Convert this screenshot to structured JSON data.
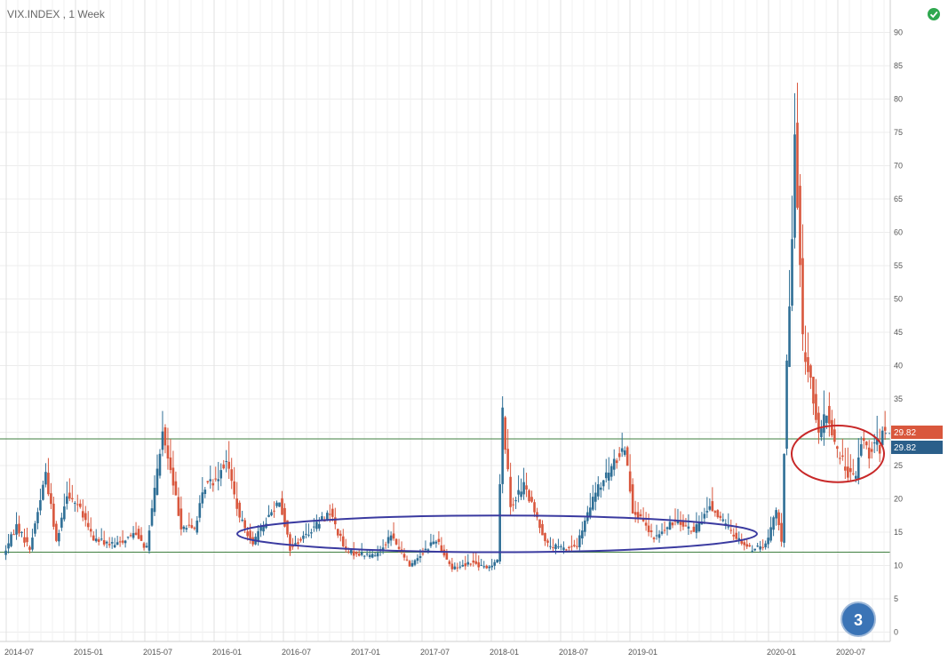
{
  "chart_data": {
    "type": "candlestick",
    "title": "VIX.INDEX , 1 Week",
    "ylim": [
      0,
      93
    ],
    "y_ticks": [
      0,
      5,
      10,
      15,
      20,
      25,
      30,
      35,
      40,
      45,
      50,
      55,
      60,
      65,
      70,
      75,
      80,
      85,
      90
    ],
    "x_tick_labels": [
      "2014-07",
      "2015-01",
      "2015-07",
      "2016-01",
      "2016-07",
      "2017-01",
      "2017-07",
      "2018-01",
      "2018-07",
      "2019-01",
      "2020-01",
      "2020-07"
    ],
    "grid": true,
    "up_color": "#2f6f96",
    "down_color": "#d9573d",
    "horizontal_levels": [
      {
        "value": 29.0,
        "color": "#3f7f3f"
      },
      {
        "value": 12.0,
        "color": "#3f7f3f"
      }
    ],
    "last_price_badges": [
      {
        "value": "29.82",
        "color": "#d9573d"
      },
      {
        "value": "29.82",
        "color": "#2b5f8a"
      }
    ],
    "annotation_marker": "3",
    "highlight_ellipses": [
      {
        "color": "#3a3aa0",
        "from": "2016-03",
        "to": "2019-12",
        "low": 12,
        "high": 17.5
      },
      {
        "color": "#c82828",
        "from": "2020-03",
        "to": "2020-11",
        "low": 22.5,
        "high": 31
      }
    ],
    "anchors": [
      [
        "2014-06-30",
        11.5
      ],
      [
        "2014-08-04",
        16
      ],
      [
        "2014-09-08",
        12.5
      ],
      [
        "2014-10-06",
        20
      ],
      [
        "2014-10-20",
        24
      ],
      [
        "2014-11-17",
        13.5
      ],
      [
        "2014-12-15",
        21
      ],
      [
        "2015-01-12",
        19
      ],
      [
        "2015-02-23",
        14
      ],
      [
        "2015-04-20",
        13
      ],
      [
        "2015-06-15",
        15
      ],
      [
        "2015-07-13",
        12.5
      ],
      [
        "2015-08-24",
        30
      ],
      [
        "2015-09-14",
        24
      ],
      [
        "2015-10-12",
        16
      ],
      [
        "2015-11-16",
        15.5
      ],
      [
        "2015-12-14",
        22
      ],
      [
        "2016-01-11",
        23
      ],
      [
        "2016-02-08",
        26
      ],
      [
        "2016-03-14",
        17
      ],
      [
        "2016-04-18",
        13.5
      ],
      [
        "2016-06-27",
        20
      ],
      [
        "2016-07-25",
        12.5
      ],
      [
        "2016-09-12",
        15
      ],
      [
        "2016-11-07",
        18
      ],
      [
        "2016-12-19",
        12
      ],
      [
        "2017-03-06",
        11.5
      ],
      [
        "2017-04-17",
        14.5
      ],
      [
        "2017-06-05",
        10
      ],
      [
        "2017-08-14",
        14
      ],
      [
        "2017-09-25",
        9.5
      ],
      [
        "2017-11-13",
        10.5
      ],
      [
        "2017-12-25",
        9.5
      ],
      [
        "2018-01-22",
        11
      ],
      [
        "2018-02-05",
        33
      ],
      [
        "2018-02-26",
        19
      ],
      [
        "2018-04-02",
        22
      ],
      [
        "2018-06-04",
        13
      ],
      [
        "2018-07-16",
        12.5
      ],
      [
        "2018-08-20",
        13
      ],
      [
        "2018-10-08",
        21
      ],
      [
        "2018-10-22",
        22
      ],
      [
        "2018-12-24",
        28
      ],
      [
        "2019-01-14",
        18.5
      ],
      [
        "2019-03-11",
        14
      ],
      [
        "2019-05-13",
        17
      ],
      [
        "2019-06-24",
        15
      ],
      [
        "2019-08-05",
        19
      ],
      [
        "2019-09-30",
        15
      ],
      [
        "2019-11-18",
        12.5
      ],
      [
        "2019-12-30",
        13
      ],
      [
        "2020-01-27",
        18
      ],
      [
        "2020-02-10",
        14
      ],
      [
        "2020-02-24",
        40
      ],
      [
        "2020-03-09",
        58
      ],
      [
        "2020-03-16",
        75
      ],
      [
        "2020-03-23",
        66
      ],
      [
        "2020-04-06",
        43
      ],
      [
        "2020-04-27",
        38
      ],
      [
        "2020-05-18",
        29
      ],
      [
        "2020-06-08",
        33
      ],
      [
        "2020-07-06",
        27
      ],
      [
        "2020-08-03",
        24
      ],
      [
        "2020-08-24",
        23
      ],
      [
        "2020-09-07",
        29
      ],
      [
        "2020-09-28",
        27
      ],
      [
        "2020-10-12",
        29
      ],
      [
        "2020-10-26",
        27.5
      ],
      [
        "2020-11-02",
        29.8
      ]
    ]
  },
  "ui": {
    "status_color": "#2fa84f"
  }
}
